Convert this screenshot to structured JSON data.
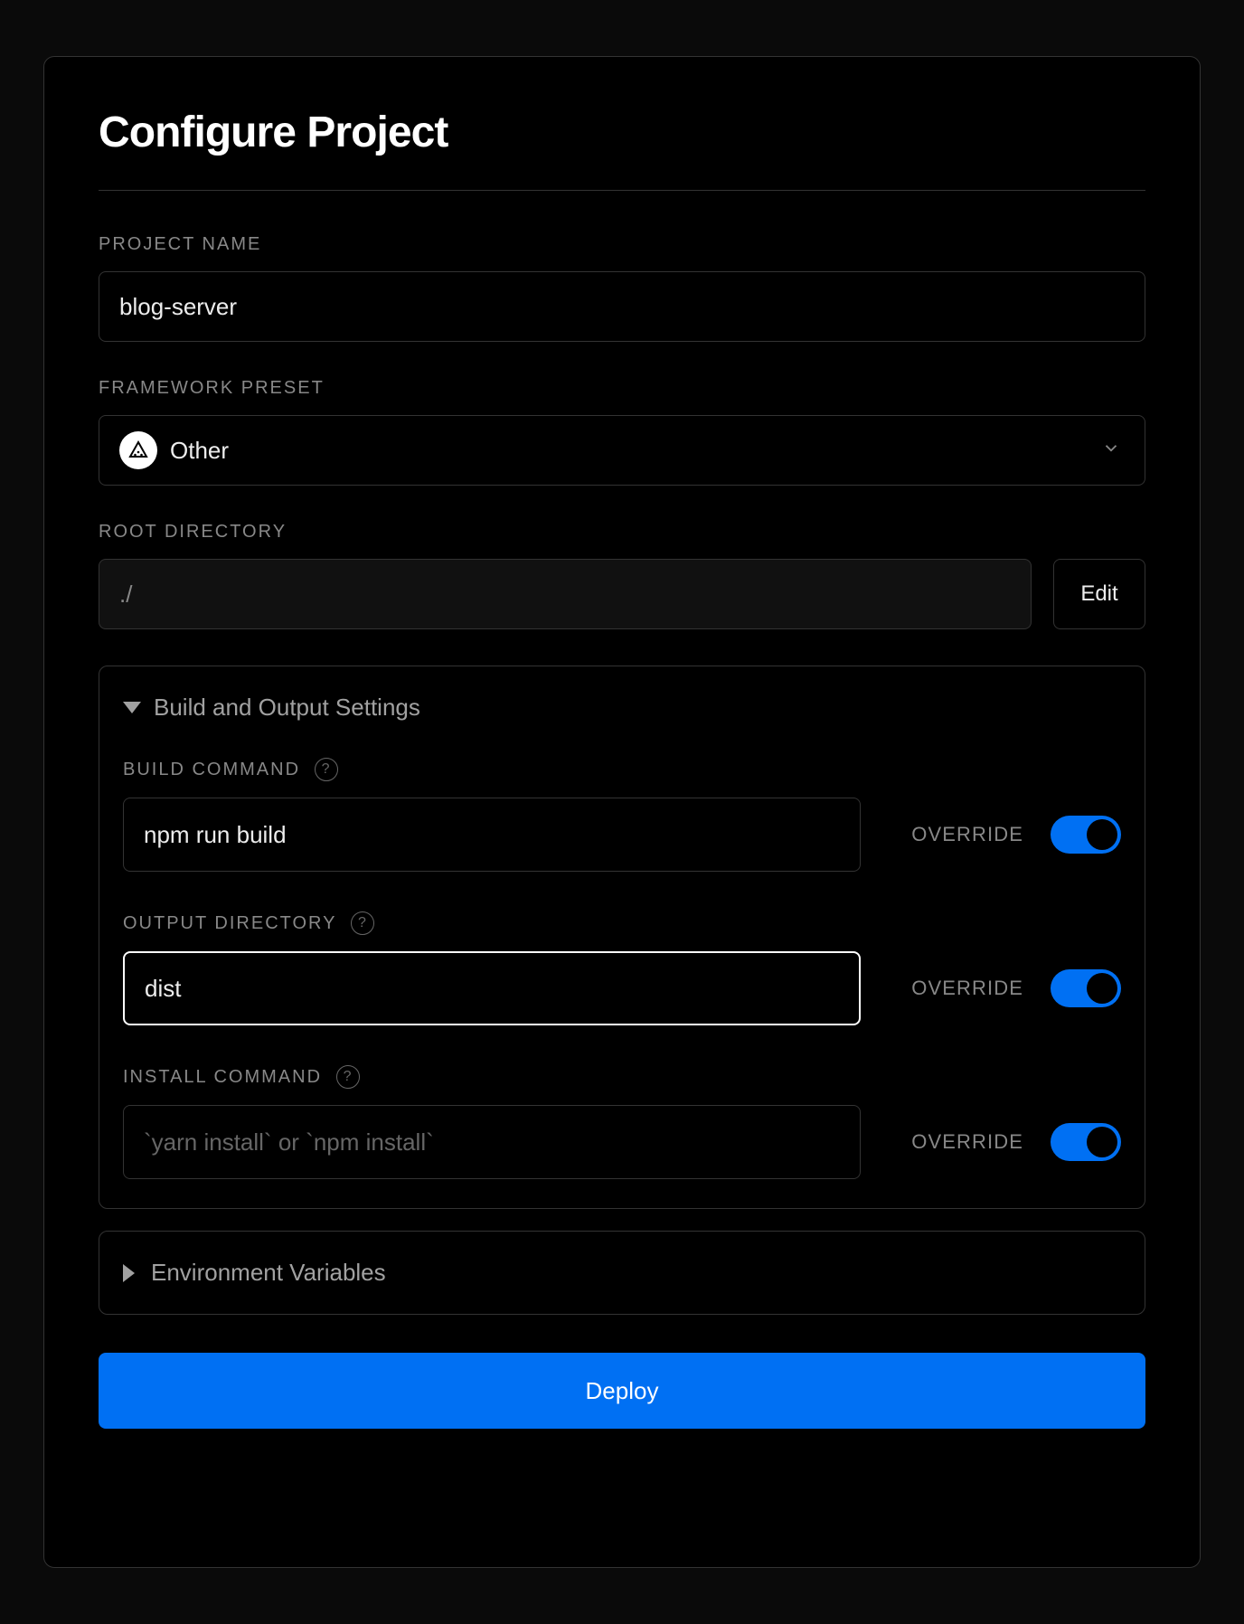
{
  "title": "Configure Project",
  "project_name": {
    "label": "PROJECT NAME",
    "value": "blog-server"
  },
  "framework": {
    "label": "FRAMEWORK PRESET",
    "value": "Other"
  },
  "root_dir": {
    "label": "ROOT DIRECTORY",
    "value": "./",
    "edit_label": "Edit"
  },
  "build_section": {
    "header": "Build and Output Settings",
    "override_label": "OVERRIDE",
    "build_command": {
      "label": "BUILD COMMAND",
      "value": "npm run build"
    },
    "output_directory": {
      "label": "OUTPUT DIRECTORY",
      "value": "dist"
    },
    "install_command": {
      "label": "INSTALL COMMAND",
      "placeholder": "`yarn install` or `npm install`",
      "value": ""
    }
  },
  "env_section": {
    "header": "Environment Variables"
  },
  "deploy_label": "Deploy"
}
